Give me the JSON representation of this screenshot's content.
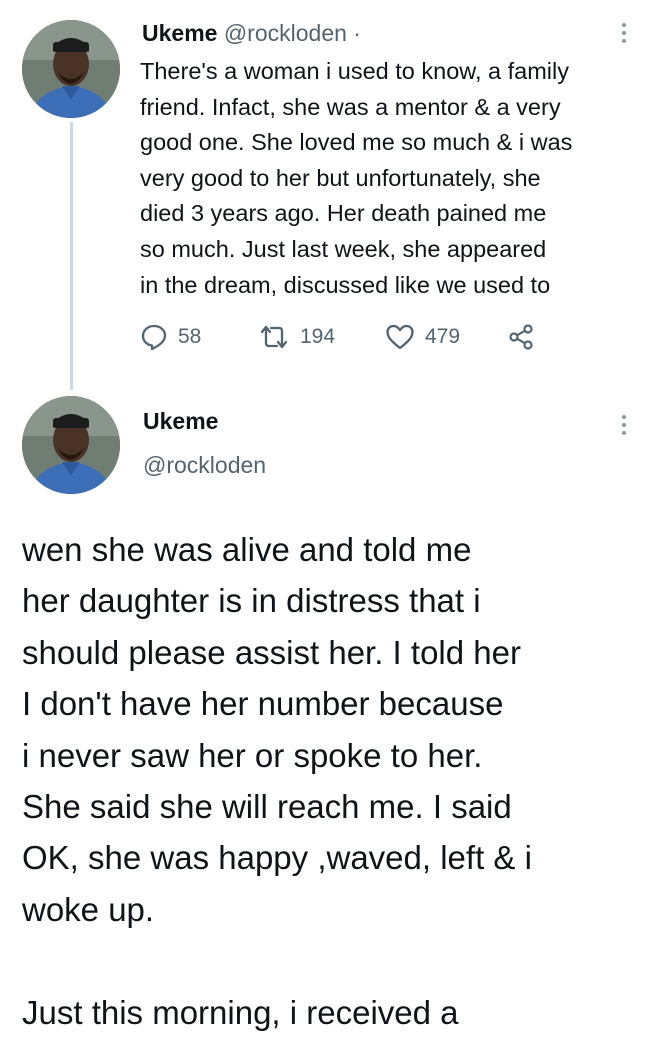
{
  "tweet1": {
    "name": "Ukeme",
    "handle": "@rockloden",
    "separator": "·",
    "text_lines": [
      "There's a woman i used to know, a family",
      "friend. Infact, she was a mentor & a very",
      "good one. She loved me so much & i was",
      "very good to her but unfortunately, she",
      "died 3 years ago. Her death pained me",
      "so much. Just last week, she appeared",
      "in the dream, discussed like we used to"
    ],
    "replies": "58",
    "retweets": "194",
    "likes": "479",
    "icons": {
      "reply": "speech-bubble-icon",
      "retweet": "retweet-arrows-icon",
      "like": "heart-icon",
      "share": "share-icon",
      "more": "vertical-dots-icon"
    }
  },
  "tweet2": {
    "name": "Ukeme",
    "handle": "@rockloden",
    "text_lines": [
      "wen she was alive and told me",
      "her daughter is in distress that i",
      "should please assist her. I told her",
      "I don't have her number because",
      "i never saw her or spoke to her.",
      "She said she will reach me. I said",
      "OK, she was happy ,waved, left & i",
      "woke up."
    ],
    "text_lines_2": [
      "Just this morning, i received a"
    ]
  },
  "colors": {
    "text": "#0f1419",
    "secondary": "#536471",
    "thread_line": "#cfd9de",
    "background": "#ffffff"
  }
}
